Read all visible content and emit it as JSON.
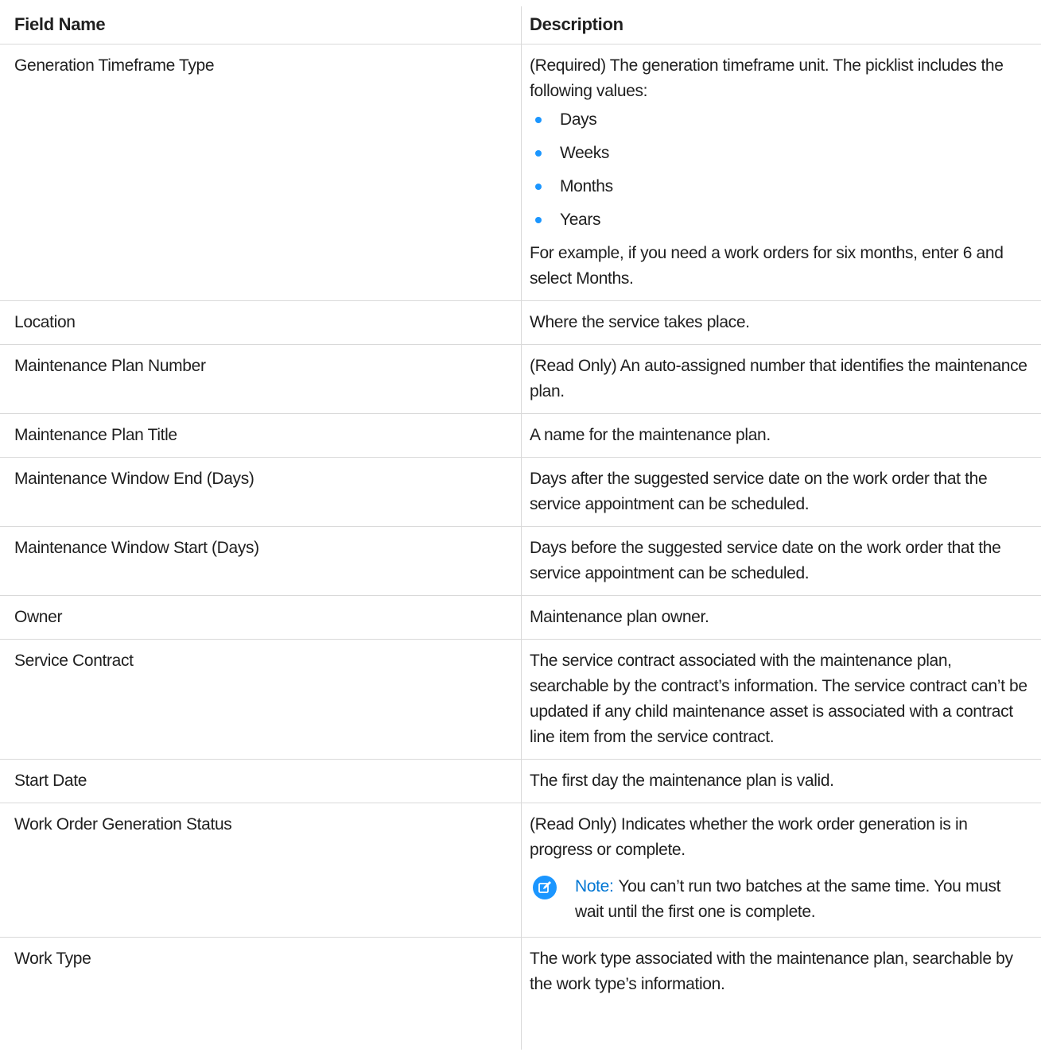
{
  "table": {
    "headers": {
      "field_name": "Field Name",
      "description": "Description"
    },
    "rows": [
      {
        "field": "Generation Timeframe Type",
        "description": "(Required) The generation timeframe unit. The picklist includes the following values:",
        "bullets": [
          "Days",
          "Weeks",
          "Months",
          "Years"
        ],
        "description_after": "For example, if you need a work orders for six months, enter 6 and select Months."
      },
      {
        "field": "Location",
        "description": "Where the service takes place."
      },
      {
        "field": "Maintenance Plan Number",
        "description": "(Read Only) An auto-assigned number that identifies the maintenance plan."
      },
      {
        "field": "Maintenance Plan Title",
        "description": "A name for the maintenance plan."
      },
      {
        "field": "Maintenance Window End (Days)",
        "description": "Days after the suggested service date on the work order that the service appointment can be scheduled."
      },
      {
        "field": "Maintenance Window Start (Days)",
        "description": "Days before the suggested service date on the work order that the service appointment can be scheduled."
      },
      {
        "field": "Owner",
        "description": "Maintenance plan owner."
      },
      {
        "field": "Service Contract",
        "description": "The service contract associated with the maintenance plan, searchable by the contract’s information. The service contract can’t be updated if any child maintenance asset is associated with a contract line item from the service contract."
      },
      {
        "field": "Start Date",
        "description": "The first day the maintenance plan is valid."
      },
      {
        "field": "Work Order Generation Status",
        "description": "(Read Only) Indicates whether the work order generation is in progress or complete.",
        "note": {
          "icon": "edit-note-icon",
          "label": "Note:",
          "text": "You can’t run two batches at the same time. You must wait until the first one is complete."
        }
      },
      {
        "field": "Work Type",
        "description": "The work type associated with the maintenance plan, searchable by the work type’s information."
      }
    ]
  },
  "colors": {
    "bullet": "#1b96ff",
    "note_icon": "#1b96ff",
    "note_label": "#0176d3",
    "divider": "#d9d9d9"
  }
}
